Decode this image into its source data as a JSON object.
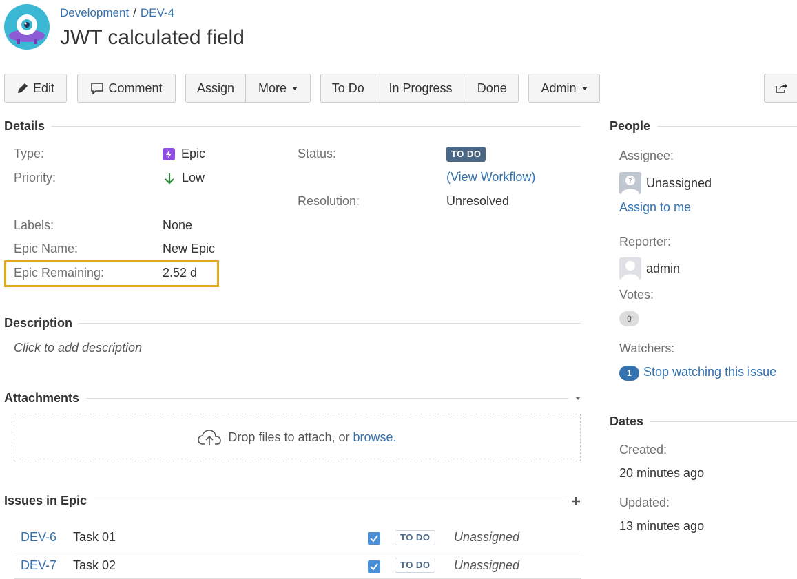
{
  "header": {
    "breadcrumb_project": "Development",
    "breadcrumb_sep": "/",
    "breadcrumb_issue": "DEV-4",
    "title": "JWT calculated field"
  },
  "toolbar": {
    "edit": "Edit",
    "comment": "Comment",
    "assign": "Assign",
    "more": "More",
    "todo": "To Do",
    "in_progress": "In Progress",
    "done": "Done",
    "admin": "Admin"
  },
  "details": {
    "heading": "Details",
    "type_label": "Type:",
    "type_value": "Epic",
    "priority_label": "Priority:",
    "priority_value": "Low",
    "status_label": "Status:",
    "status_value": "TO DO",
    "view_workflow_open": "(",
    "view_workflow": "View Workflow",
    "view_workflow_close": ")",
    "resolution_label": "Resolution:",
    "resolution_value": "Unresolved",
    "labels_label": "Labels:",
    "labels_value": "None",
    "epic_name_label": "Epic Name:",
    "epic_name_value": "New Epic",
    "epic_remaining_label": "Epic Remaining:",
    "epic_remaining_value": "2.52 d"
  },
  "description": {
    "heading": "Description",
    "placeholder": "Click to add description"
  },
  "attachments": {
    "heading": "Attachments",
    "drop_text": "Drop files to attach, or",
    "browse": "browse",
    "period": "."
  },
  "issues_in_epic": {
    "heading": "Issues in Epic",
    "rows": [
      {
        "key": "DEV-6",
        "summary": "Task 01",
        "status": "TO DO",
        "assignee": "Unassigned"
      },
      {
        "key": "DEV-7",
        "summary": "Task 02",
        "status": "TO DO",
        "assignee": "Unassigned"
      }
    ]
  },
  "people": {
    "heading": "People",
    "assignee_label": "Assignee:",
    "assignee_value": "Unassigned",
    "assign_to_me": "Assign to me",
    "reporter_label": "Reporter:",
    "reporter_value": "admin",
    "votes_label": "Votes:",
    "votes_count": "0",
    "watchers_label": "Watchers:",
    "watchers_count": "1",
    "stop_watching": "Stop watching this issue"
  },
  "dates": {
    "heading": "Dates",
    "created_label": "Created:",
    "created_value": "20 minutes ago",
    "updated_label": "Updated:",
    "updated_value": "13 minutes ago"
  },
  "colors": {
    "link": "#3572b0",
    "status_lozenge": "#4a6785",
    "highlight": "#e4a91b",
    "epic_icon": "#904ee2",
    "priority_low": "#2d8738"
  }
}
